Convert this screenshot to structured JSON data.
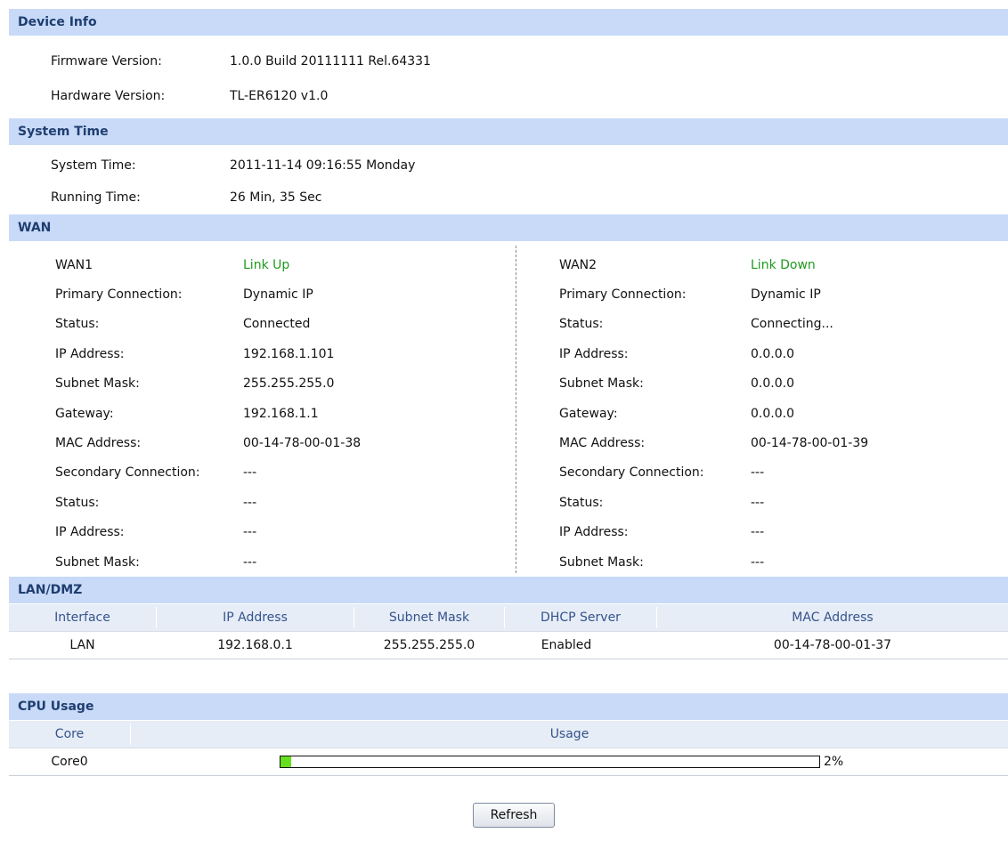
{
  "device_info": {
    "title": "Device Info",
    "firmware_label": "Firmware Version:",
    "firmware_value": "1.0.0 Build 20111111 Rel.64331",
    "hardware_label": "Hardware Version:",
    "hardware_value": "TL-ER6120 v1.0"
  },
  "system_time": {
    "title": "System Time",
    "time_label": "System Time:",
    "time_value": "2011-11-14 09:16:55 Monday",
    "running_label": "Running Time:",
    "running_value": "26 Min, 35 Sec"
  },
  "wan": {
    "title": "WAN",
    "ports": [
      {
        "name": "WAN1",
        "link": "Link Up",
        "rows": [
          {
            "label": "Primary Connection:",
            "value": "Dynamic IP"
          },
          {
            "label": "Status:",
            "value": "Connected"
          },
          {
            "label": "IP Address:",
            "value": "192.168.1.101"
          },
          {
            "label": "Subnet Mask:",
            "value": "255.255.255.0"
          },
          {
            "label": "Gateway:",
            "value": "192.168.1.1"
          },
          {
            "label": "MAC Address:",
            "value": "00-14-78-00-01-38"
          },
          {
            "label": "Secondary Connection:",
            "value": "---"
          },
          {
            "label": "Status:",
            "value": "---"
          },
          {
            "label": "IP Address:",
            "value": "---"
          },
          {
            "label": "Subnet Mask:",
            "value": "---"
          }
        ]
      },
      {
        "name": "WAN2",
        "link": "Link Down",
        "rows": [
          {
            "label": "Primary Connection:",
            "value": "Dynamic IP"
          },
          {
            "label": "Status:",
            "value": "Connecting..."
          },
          {
            "label": "IP Address:",
            "value": "0.0.0.0"
          },
          {
            "label": "Subnet Mask:",
            "value": "0.0.0.0"
          },
          {
            "label": "Gateway:",
            "value": "0.0.0.0"
          },
          {
            "label": "MAC Address:",
            "value": "00-14-78-00-01-39"
          },
          {
            "label": "Secondary Connection:",
            "value": "---"
          },
          {
            "label": "Status:",
            "value": "---"
          },
          {
            "label": "IP Address:",
            "value": "---"
          },
          {
            "label": "Subnet Mask:",
            "value": "---"
          }
        ]
      }
    ]
  },
  "lan": {
    "title": "LAN/DMZ",
    "columns": [
      "Interface",
      "IP Address",
      "Subnet Mask",
      "DHCP Server",
      "MAC Address"
    ],
    "rows": [
      [
        "LAN",
        "192.168.0.1",
        "255.255.255.0",
        "Enabled",
        "00-14-78-00-01-37"
      ]
    ]
  },
  "cpu": {
    "title": "CPU Usage",
    "columns": [
      "Core",
      "Usage"
    ],
    "cores": [
      {
        "name": "Core0",
        "usage_percent": 2,
        "usage_text": "2%"
      }
    ],
    "bar_color": "#66e01e"
  },
  "refresh_label": "Refresh",
  "colors": {
    "section_bar": "#c8daf8",
    "section_title": "#1f3e70",
    "link_status": "#1f9a1f",
    "table_header_text": "#34538d"
  }
}
